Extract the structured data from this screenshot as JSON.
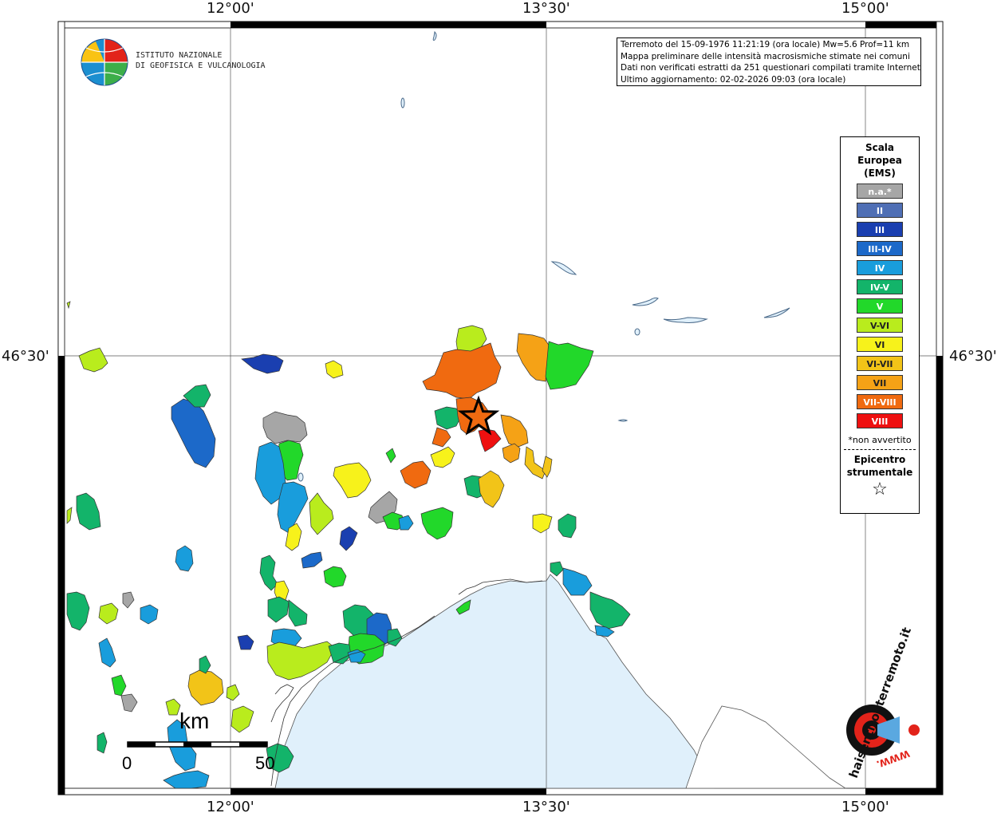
{
  "header": {
    "lines": [
      "Terremoto del 15-09-1976 11:21:19 (ora locale) Mw=5.6 Prof=11 km",
      "Mappa preliminare delle intensità macrosismiche stimate nei comuni",
      "Dati non verificati estratti da 251 questionari compilati tramite Internet.",
      "Ultimo aggiornamento: 02-02-2026 09:03 (ora locale)"
    ]
  },
  "logo": {
    "line1": "ISTITUTO NAZIONALE",
    "line2": "DI GEOFISICA E VULCANOLOGIA",
    "icon": "ingv-globe-icon"
  },
  "frame": {
    "lon_top": [
      "12°00'",
      "13°30'",
      "15°00'"
    ],
    "lon_bottom": [
      "12°00'",
      "13°30'",
      "15°00'"
    ],
    "lat_left": "46°30'",
    "lat_right": "46°30'"
  },
  "legend": {
    "title_lines": [
      "Scala",
      "Europea",
      "(EMS)"
    ],
    "items": [
      {
        "label": "n.a.*",
        "color": "#a6a6a6"
      },
      {
        "label": "II",
        "color": "#4f6fb5"
      },
      {
        "label": "III",
        "color": "#1a3fb0"
      },
      {
        "label": "III-IV",
        "color": "#1c69c9"
      },
      {
        "label": "IV",
        "color": "#199ddc"
      },
      {
        "label": "IV-V",
        "color": "#13b46a"
      },
      {
        "label": "V",
        "color": "#22d82a"
      },
      {
        "label": "V-VI",
        "color": "#b9ec1d"
      },
      {
        "label": "VI",
        "color": "#f7f21b"
      },
      {
        "label": "VI-VII",
        "color": "#f2c418"
      },
      {
        "label": "VII",
        "color": "#f5a216"
      },
      {
        "label": "VII-VIII",
        "color": "#f06a10"
      },
      {
        "label": "VIII",
        "color": "#ee1010"
      }
    ],
    "note": "*non avvertito",
    "epicenter_lines": [
      "Epicentro",
      "strumentale"
    ],
    "epicenter_symbol": "☆"
  },
  "scalebar": {
    "unit": "km",
    "start": "0",
    "end": "50"
  },
  "watermark": {
    "text": "haisentitoilterremoto.it",
    "url": "WWW."
  },
  "map": {
    "sea_color": "#e0f0fb",
    "epicenter_icon": "star-epicenter-icon"
  }
}
